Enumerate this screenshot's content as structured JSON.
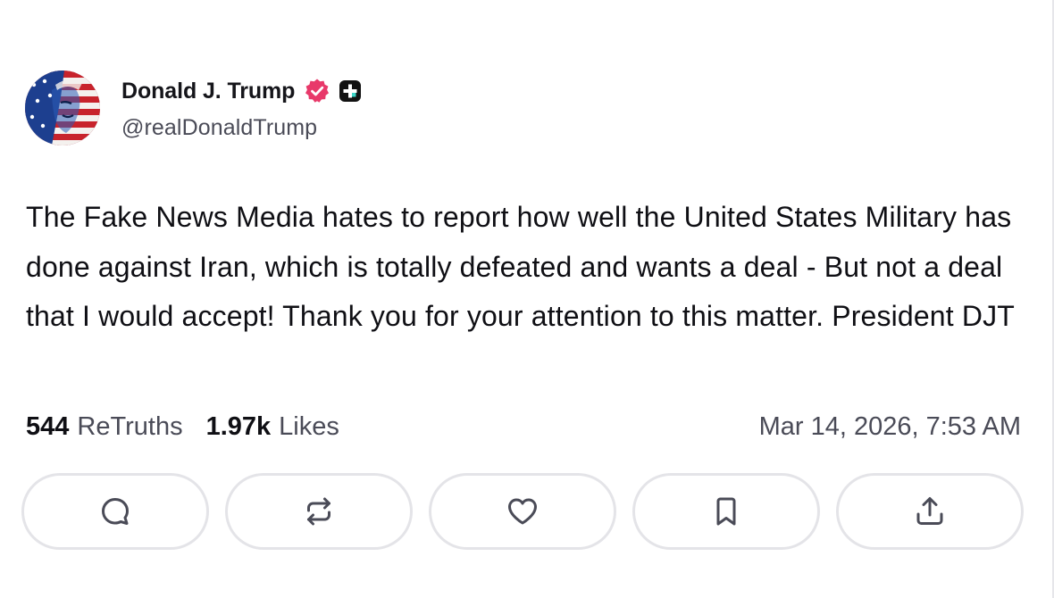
{
  "author": {
    "display_name": "Donald J. Trump",
    "handle": "@realDonaldTrump",
    "verified_icon": "verified-badge-icon",
    "plus_icon": "plus-badge-icon"
  },
  "post": {
    "text": "The Fake News Media hates to report how well the United States Military has done against Iran, which is totally defeated and wants a deal - But not a deal that I would accept! Thank you for your attention to this matter. President DJT"
  },
  "stats": {
    "retruths_count": "544",
    "retruths_label": "ReTruths",
    "likes_count": "1.97k",
    "likes_label": "Likes",
    "timestamp": "Mar 14, 2026, 7:53 AM"
  },
  "actions": [
    {
      "name": "reply",
      "icon": "comment-icon"
    },
    {
      "name": "retruth",
      "icon": "repost-icon"
    },
    {
      "name": "like",
      "icon": "heart-icon"
    },
    {
      "name": "bookmark",
      "icon": "bookmark-icon"
    },
    {
      "name": "share",
      "icon": "share-icon"
    }
  ],
  "colors": {
    "verified": "#e8396a",
    "plus_badge": "#111111",
    "text_primary": "#0f0f14",
    "text_secondary": "#4a4b57",
    "icon": "#4a4b57",
    "border": "#e4e4e8"
  }
}
